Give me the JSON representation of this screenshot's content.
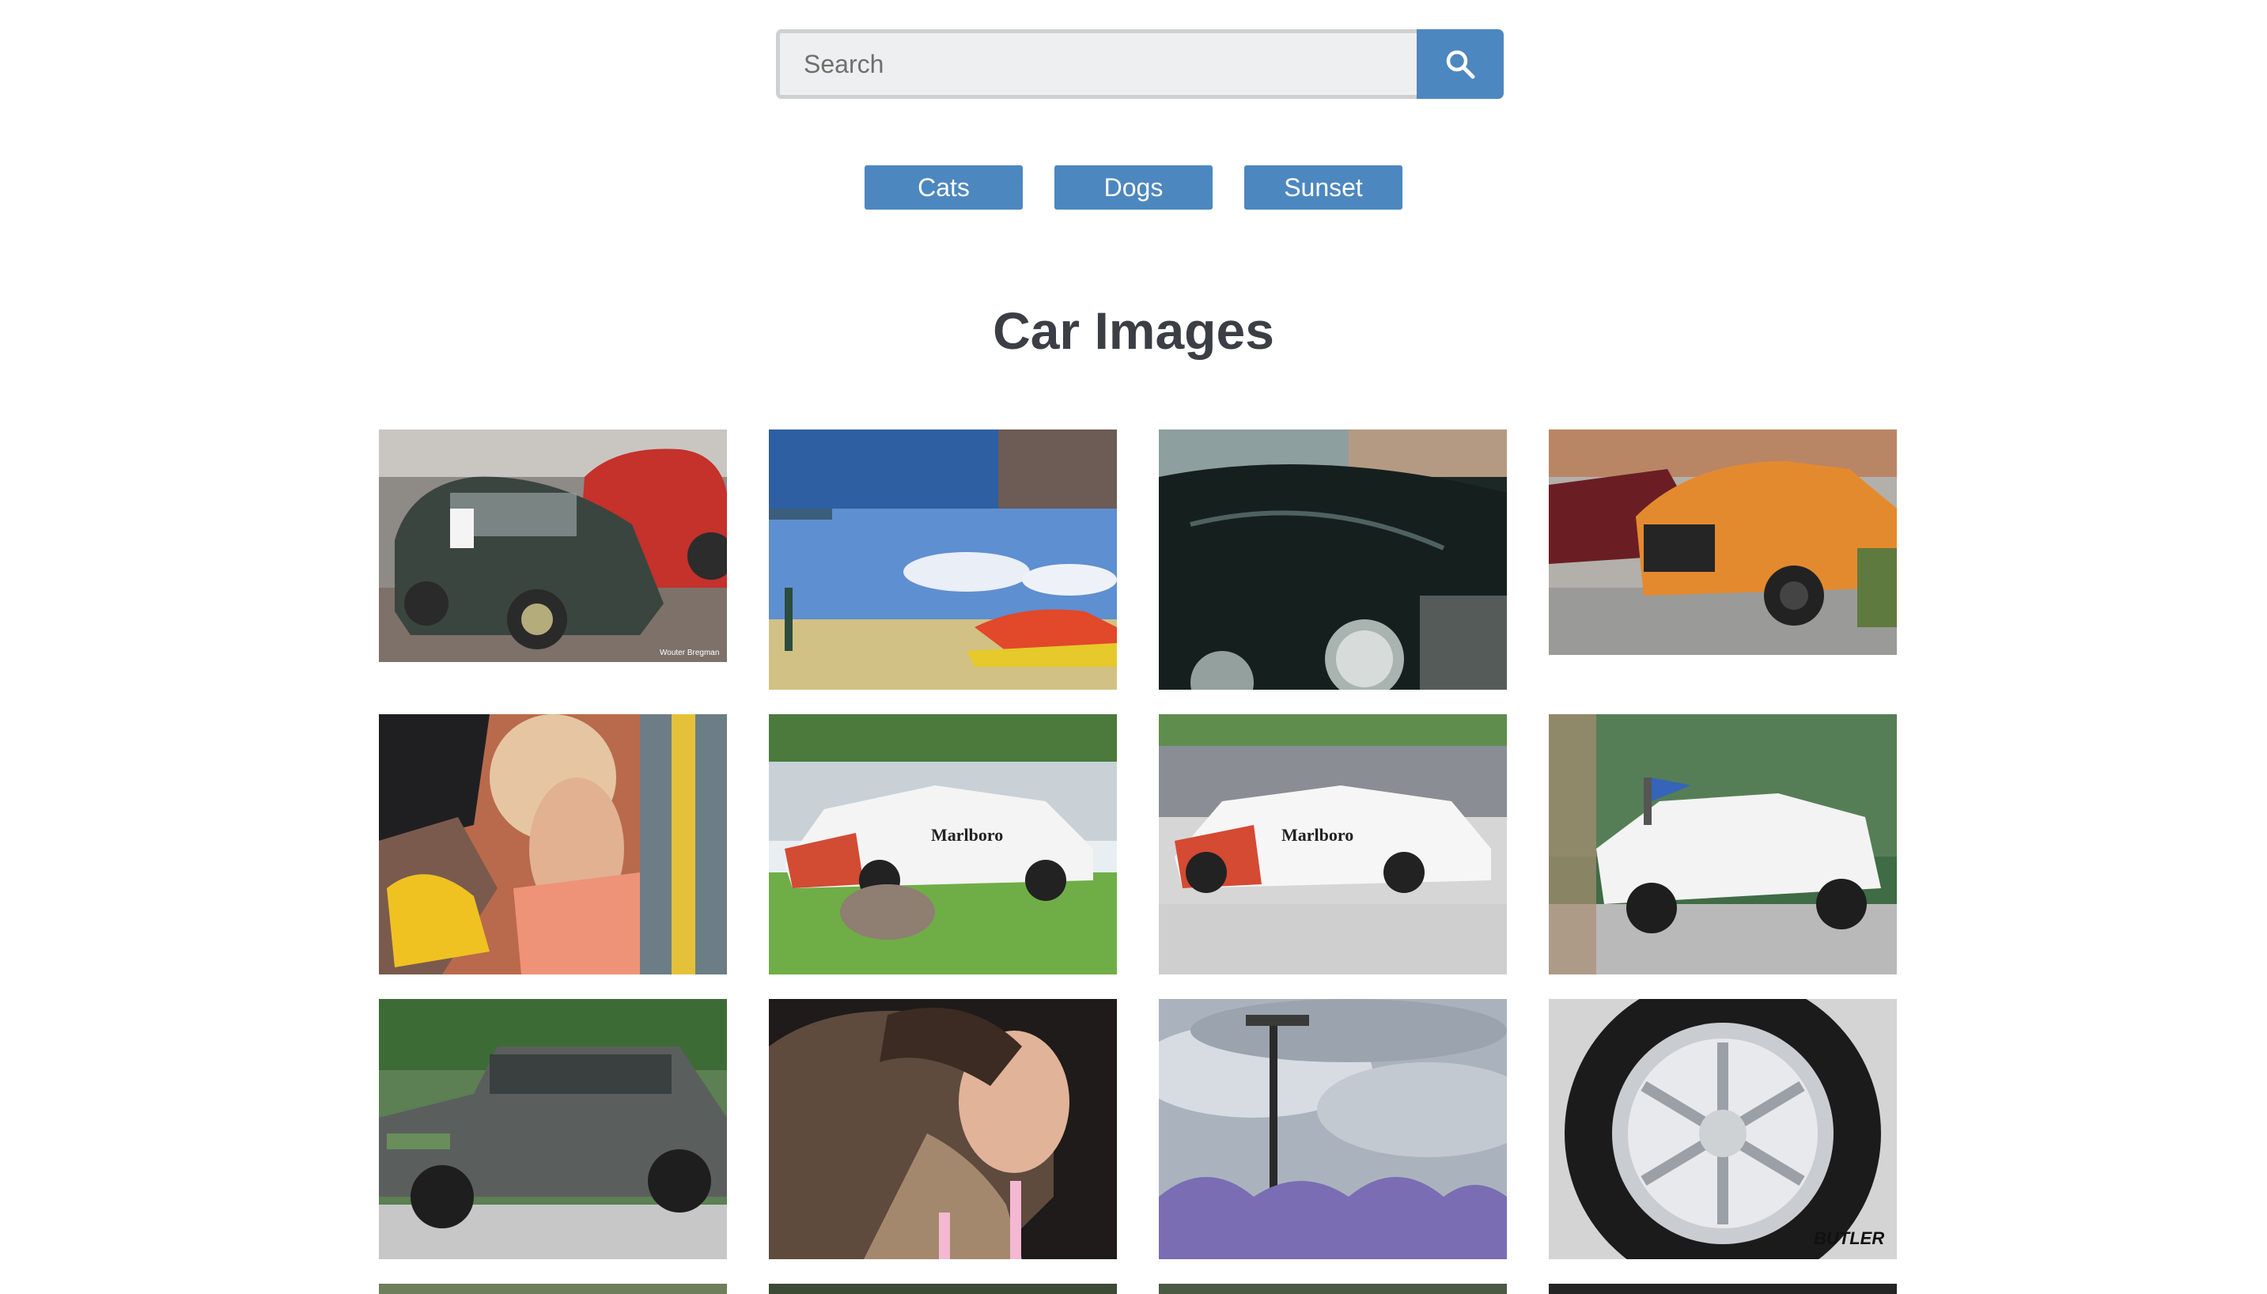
{
  "search": {
    "placeholder": "Search",
    "value": "",
    "icon": "search-icon"
  },
  "categories": [
    "Cats",
    "Dogs",
    "Sunset"
  ],
  "section_title": "Car Images",
  "watermarks": {
    "tile_1": "Wouter Bregman",
    "tile_12": "BUTLER"
  },
  "colors": {
    "accent": "#4d87bf",
    "title": "#3b3f45"
  }
}
